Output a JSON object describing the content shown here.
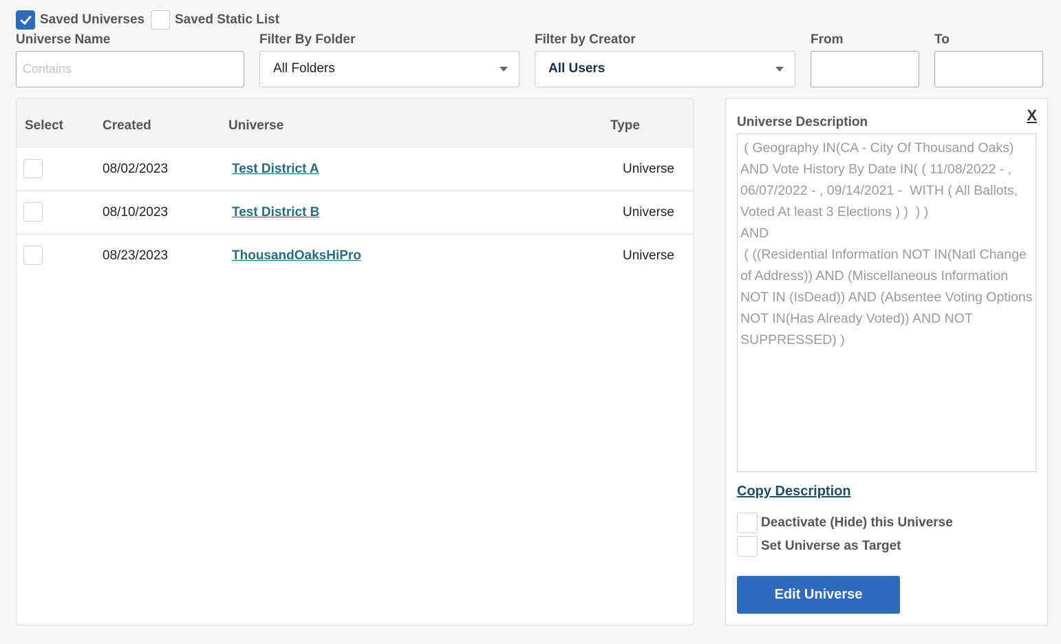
{
  "filters": {
    "saved_universes_label": "Saved Universes",
    "saved_universes_checked": true,
    "saved_static_list_label": "Saved Static List",
    "saved_static_list_checked": false,
    "universe_name_label": "Universe Name",
    "universe_name_placeholder": "Contains",
    "universe_name_value": "",
    "folder_label": "Filter By Folder",
    "folder_value": "All Folders",
    "creator_label": "Filter by Creator",
    "creator_value": "All Users",
    "from_label": "From",
    "from_value": "",
    "to_label": "To",
    "to_value": ""
  },
  "table": {
    "headers": {
      "select": "Select",
      "created": "Created",
      "universe": "Universe",
      "type": "Type"
    },
    "rows": [
      {
        "created": "08/02/2023",
        "universe": "Test District A",
        "type": "Universe"
      },
      {
        "created": "08/10/2023",
        "universe": "Test District B",
        "type": "Universe"
      },
      {
        "created": "08/23/2023",
        "universe": "ThousandOaksHiPro",
        "type": "Universe"
      }
    ]
  },
  "details": {
    "close_label": "X",
    "title": "Universe Description",
    "description": " ( Geography IN(CA - City Of Thousand Oaks) AND Vote History By Date IN( ( 11/08/2022 - , 06/07/2022 - , 09/14/2021 -  WITH ( All Ballots, Voted At least 3 Elections ) )  ) )\nAND\n ( ((Residential Information NOT IN(Natl Change of Address)) AND (Miscellaneous Information NOT IN (IsDead)) AND (Absentee Voting Options NOT IN(Has Already Voted)) AND NOT SUPPRESSED) )",
    "copy_label": "Copy Description",
    "deactivate_label": "Deactivate (Hide) this Universe",
    "target_label": "Set Universe as Target",
    "edit_button": "Edit Universe"
  }
}
